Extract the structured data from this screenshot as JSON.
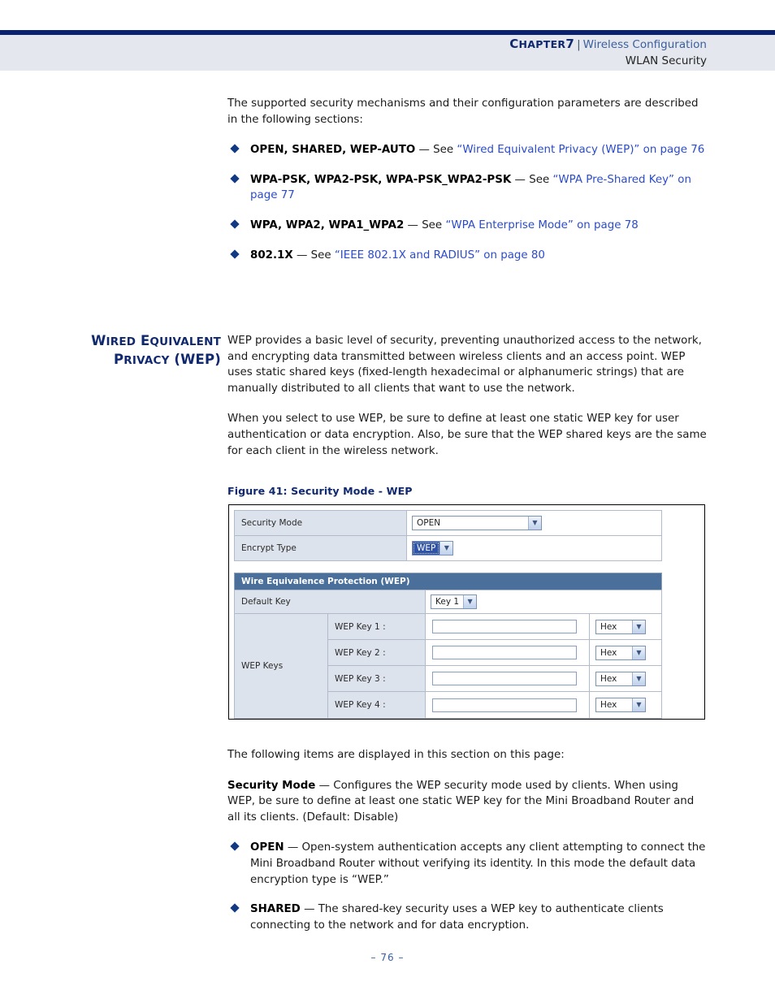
{
  "header": {
    "chapter_label": "Chapter 7",
    "chapter_cap": "C",
    "chapter_rest": "HAPTER",
    "chapter_num": "7",
    "separator": "|",
    "section": "Wireless Configuration",
    "subsection": "WLAN Security"
  },
  "intro": "The supported security mechanisms and their configuration parameters are described in the following sections:",
  "mechanisms": [
    {
      "term": "OPEN, SHARED, WEP-AUTO",
      "dash": "—",
      "see": "See",
      "link": "“Wired Equivalent Privacy (WEP)” on page 76"
    },
    {
      "term": "WPA-PSK, WPA2-PSK, WPA-PSK_WPA2-PSK",
      "dash": "—",
      "see": "See",
      "link": "“WPA Pre-Shared Key” on page 77"
    },
    {
      "term": "WPA, WPA2, WPA1_WPA2",
      "dash": "—",
      "see": "See",
      "link": "“WPA Enterprise Mode” on page 78"
    },
    {
      "term": "802.1X",
      "dash": "—",
      "see": "See",
      "link": "“IEEE 802.1X and RADIUS” on page 80"
    }
  ],
  "side_heading": {
    "line1_cap1": "W",
    "line1_sc1": "IRED",
    "line1_cap2": "E",
    "line1_sc2": "QUIVALENT",
    "line2_cap1": "P",
    "line2_sc1": "RIVACY",
    "line2_rest": "(WEP)",
    "full": "Wired Equivalent Privacy (WEP)"
  },
  "wep_paragraphs": [
    "WEP provides a basic level of security, preventing unauthorized access to the network, and encrypting data transmitted between wireless clients and an access point. WEP uses static shared keys (fixed-length hexadecimal or alphanumeric strings) that are manually distributed to all clients that want to use the network.",
    "When you select to use WEP, be sure to define at least one static WEP key for user authentication or data encryption. Also, be sure that the WEP shared keys are the same for each client in the wireless network."
  ],
  "figure": {
    "caption": "Figure 41:  Security Mode - WEP",
    "security_mode": {
      "label": "Security Mode",
      "value": "OPEN",
      "arrow_icon": "chevron-down-icon"
    },
    "encrypt_type": {
      "label": "Encrypt Type",
      "value": "WEP",
      "arrow_icon": "chevron-down-icon"
    },
    "section_title": "Wire Equivalence Protection (WEP)",
    "default_key": {
      "label": "Default Key",
      "value": "Key 1",
      "arrow_icon": "chevron-down-icon"
    },
    "keys_label": "WEP Keys",
    "keys": [
      {
        "name": "WEP Key 1 :",
        "value": "",
        "type": "Hex"
      },
      {
        "name": "WEP Key 2 :",
        "value": "",
        "type": "Hex"
      },
      {
        "name": "WEP Key 3 :",
        "value": "",
        "type": "Hex"
      },
      {
        "name": "WEP Key 4 :",
        "value": "",
        "type": "Hex"
      }
    ],
    "colors": {
      "section_bar": "#4a6f9b",
      "label_cell": "#dde3ec",
      "highlight": "#2f53a7"
    }
  },
  "after_figure": {
    "lead": "The following items are displayed in this section on this page:",
    "security_mode_term": "Security Mode",
    "security_mode_dash": "—",
    "security_mode_desc": "Configures the WEP security mode used by clients. When using WEP, be sure to define at least one static WEP key for the Mini Broadband Router and all its clients. (Default: Disable)",
    "modes": [
      {
        "term": "OPEN",
        "dash": "—",
        "desc": "Open-system authentication accepts any client attempting to connect the Mini Broadband Router without verifying its identity. In this mode the default data encryption type is “WEP.”"
      },
      {
        "term": "SHARED",
        "dash": "—",
        "desc": "The shared-key security uses a WEP key to authenticate clients connecting to the network and for data encryption."
      }
    ]
  },
  "footer": {
    "page": "–  76  –"
  }
}
